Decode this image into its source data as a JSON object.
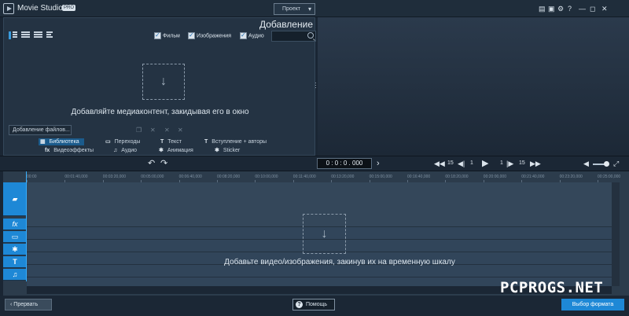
{
  "titlebar": {
    "app_name": "Movie Studio",
    "badge": "PRO",
    "project_menu": "Проект",
    "icons": [
      "chat-icon",
      "cart-icon",
      "gear-icon",
      "minimize-icon",
      "close-icon"
    ]
  },
  "library": {
    "title": "Добавление",
    "filters": [
      {
        "label": "Фильм",
        "checked": true
      },
      {
        "label": "Изображения",
        "checked": true
      },
      {
        "label": "Аудио",
        "checked": true
      }
    ],
    "search_value": "",
    "hint": "Добавляйте медиаконтент, закидывая его в окно",
    "add_files": "Добавление файлов...",
    "tabs": [
      {
        "icon": "library-icon",
        "label": "Библиотека",
        "active": true
      },
      {
        "icon": "transitions-icon",
        "label": "Переходы",
        "active": false
      },
      {
        "icon": "T",
        "label": "Текст",
        "active": false
      },
      {
        "icon": "T",
        "label": "Вступление + авторы",
        "active": false
      },
      {
        "icon": "fx",
        "label": "Видеоэффекты",
        "active": false
      },
      {
        "icon": "♫",
        "label": "Аудио",
        "active": false
      },
      {
        "icon": "✱",
        "label": "Анимация",
        "active": false
      },
      {
        "icon": "✱",
        "label": "Sticker",
        "active": false
      }
    ]
  },
  "transport": {
    "timecode": "0 : 0 : 0 . 000",
    "skip_back": "15",
    "frame_back": "1",
    "frame_forward": "1",
    "skip_forward": "15"
  },
  "timeline": {
    "ruler": [
      "00:00",
      "00:01:40,000",
      "00:03:20,000",
      "00:05:00,000",
      "00:06:40,000",
      "00:08:20,000",
      "00:10:00,000",
      "00:11:40,000",
      "00:13:20,000",
      "00:15:00,000",
      "00:16:40,000",
      "00:18:20,000",
      "00:20:00,000",
      "00:21:40,000",
      "00:23:20,000",
      "00:25:00,000"
    ],
    "hint": "Добавьте видео/изображения, закинув их на временную шкалу"
  },
  "bottombar": {
    "back": "Прервать",
    "help": "Помощь",
    "format": "Выбор формата"
  },
  "watermark": "PCPROGS.NET"
}
